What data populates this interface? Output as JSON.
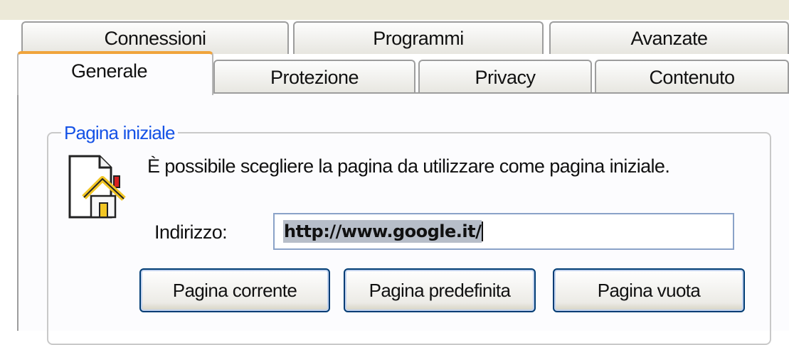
{
  "tabs": {
    "row1": [
      "Connessioni",
      "Programmi",
      "Avanzate"
    ],
    "row2": [
      "Generale",
      "Protezione",
      "Privacy",
      "Contenuto"
    ],
    "active": "Generale"
  },
  "home_page": {
    "group_title": "Pagina iniziale",
    "description": "È possibile scegliere la pagina da utilizzare come pagina iniziale.",
    "address_label": "Indirizzo:",
    "address_value": "http://www.google.it/",
    "buttons": {
      "current": "Pagina corrente",
      "default": "Pagina predefinita",
      "blank": "Pagina vuota"
    }
  },
  "colors": {
    "group_title": "#1552e6",
    "active_tab_accent": "#f0a43c",
    "button_border": "#003c74"
  },
  "icons": {
    "home_page": "home-page-icon"
  }
}
